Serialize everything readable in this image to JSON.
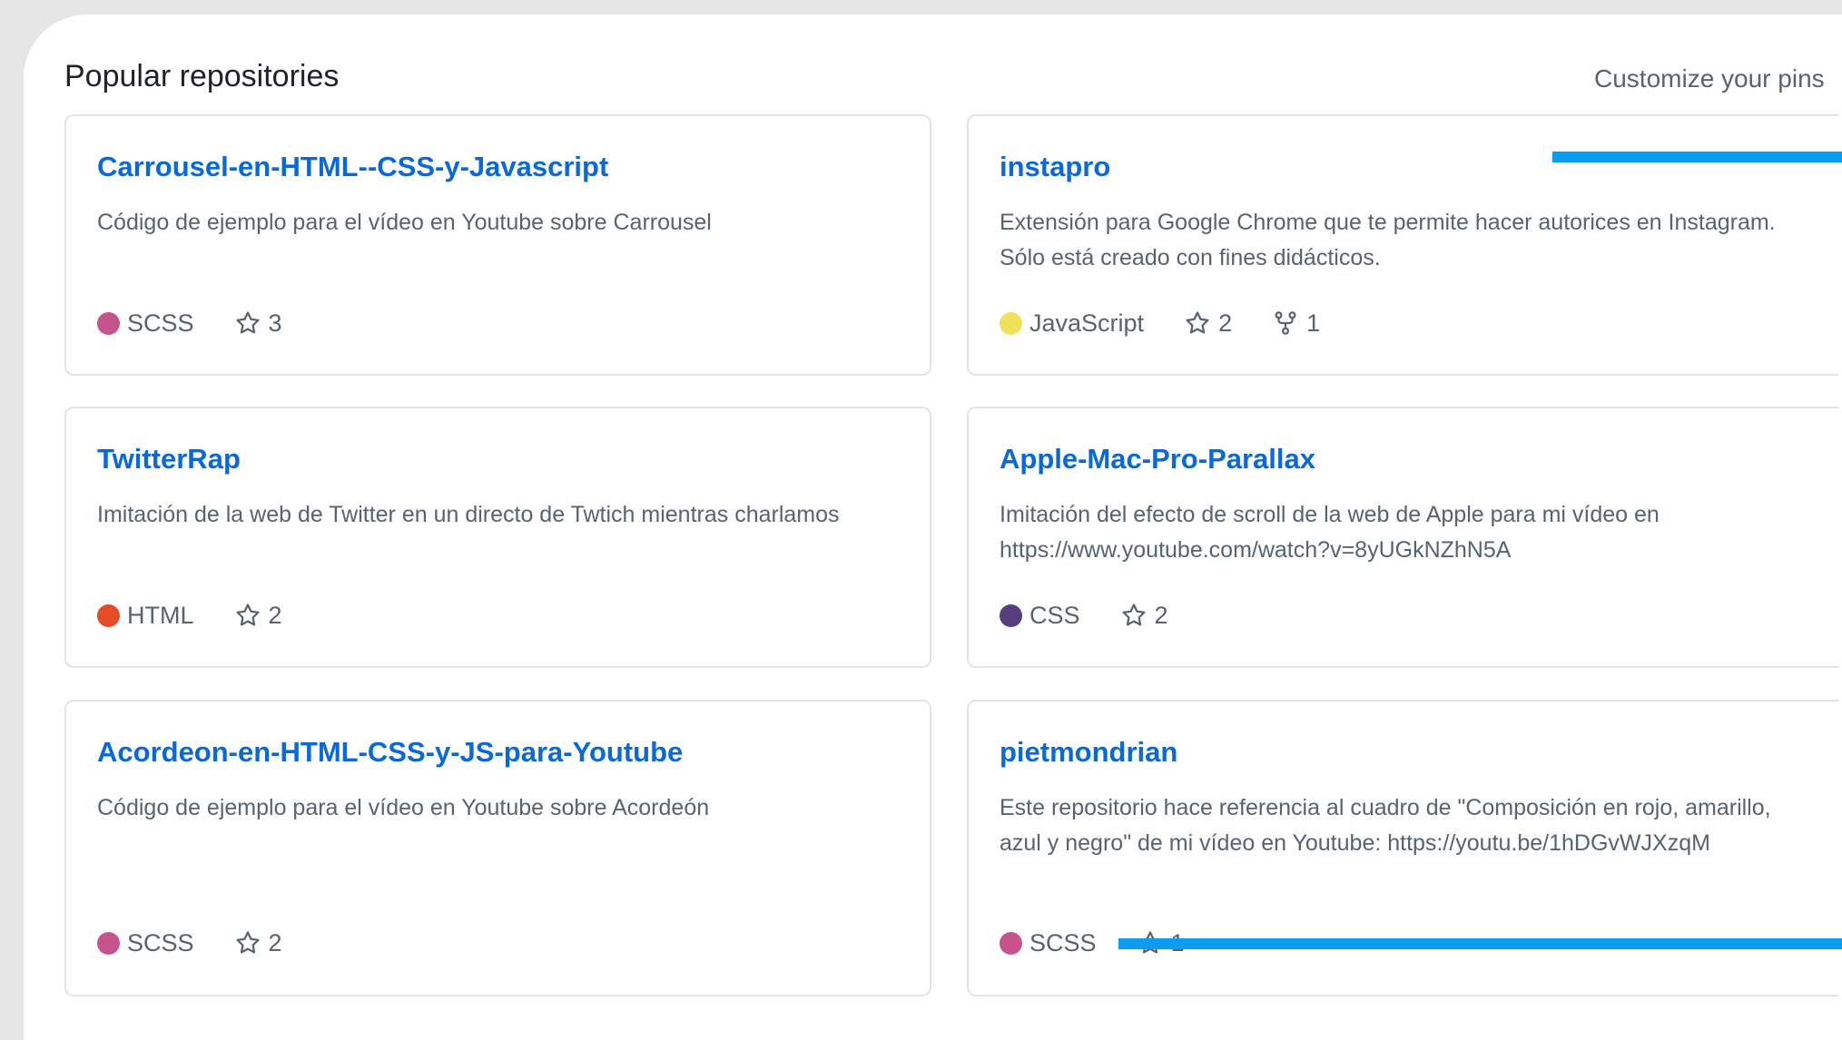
{
  "section": {
    "title": "Popular repositories",
    "customize_label": "Customize your pins"
  },
  "repos": [
    {
      "name": "Carrousel-en-HTML--CSS-y-Javascript",
      "description": "Código de ejemplo para el vídeo en Youtube sobre Carrousel",
      "language": "SCSS",
      "language_color": "#c6538c",
      "stars": "3",
      "forks": null
    },
    {
      "name": "instapro",
      "description": "Extensión para Google Chrome que te permite hacer autorices en Instagram. Sólo está creado con fines didácticos.",
      "language": "JavaScript",
      "language_color": "#f1e05a",
      "stars": "2",
      "forks": "1"
    },
    {
      "name": "TwitterRap",
      "description": "Imitación de la web de Twitter en un directo de Twtich mientras charlamos",
      "language": "HTML",
      "language_color": "#e34c26",
      "stars": "2",
      "forks": null
    },
    {
      "name": "Apple-Mac-Pro-Parallax",
      "description": "Imitación del efecto de scroll de la web de Apple para mi vídeo en https://www.youtube.com/watch?v=8yUGkNZhN5A",
      "language": "CSS",
      "language_color": "#563d7c",
      "stars": "2",
      "forks": null
    },
    {
      "name": "Acordeon-en-HTML-CSS-y-JS-para-Youtube",
      "description": "Código de ejemplo para el vídeo en Youtube sobre Acordeón",
      "language": "SCSS",
      "language_color": "#c6538c",
      "stars": "2",
      "forks": null
    },
    {
      "name": "pietmondrian",
      "description": "Este repositorio hace referencia al cuadro de \"Composición en rojo, amarillo, azul y negro\" de mi vídeo en Youtube: https://youtu.be/1hDGvWJXzqM",
      "language": "SCSS",
      "language_color": "#c6538c",
      "stars": "1",
      "forks": null
    }
  ],
  "colors": {
    "link": "#0969da",
    "muted_text": "#59636e",
    "annotation_line": "#0a9cf0"
  },
  "icons": {
    "star": "star-icon",
    "fork": "repo-forked-icon"
  }
}
